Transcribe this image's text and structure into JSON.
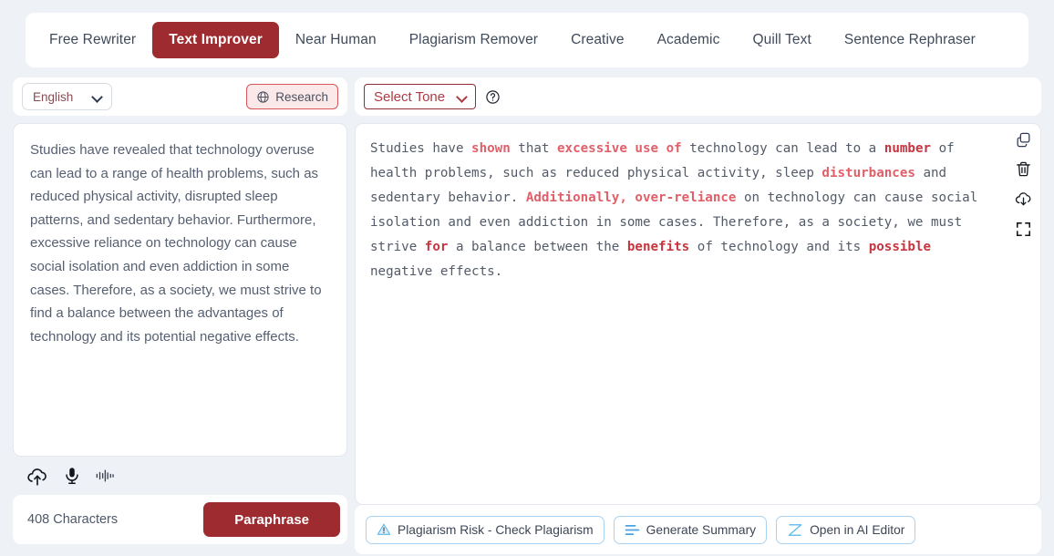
{
  "tabs": [
    {
      "label": "Free Rewriter",
      "active": false
    },
    {
      "label": "Text Improver",
      "active": true
    },
    {
      "label": "Near Human",
      "active": false
    },
    {
      "label": "Plagiarism Remover",
      "active": false
    },
    {
      "label": "Creative",
      "active": false
    },
    {
      "label": "Academic",
      "active": false
    },
    {
      "label": "Quill Text",
      "active": false
    },
    {
      "label": "Sentence Rephraser",
      "active": false
    }
  ],
  "left": {
    "language": "English",
    "research_label": "Research",
    "research_icon": "globe-icon",
    "input_text": "Studies have revealed that technology overuse can lead to a range of health problems, such as reduced physical activity, disrupted sleep patterns, and sedentary behavior. Furthermore, excessive reliance on technology can cause social isolation and even addiction in some cases. Therefore, as a society, we must strive to find a balance between the advantages of technology and its potential negative effects.",
    "media_icons": [
      "cloud-upload-icon",
      "microphone-icon",
      "waveform-icon"
    ],
    "char_count": "408 Characters",
    "paraphrase_label": "Paraphrase"
  },
  "right": {
    "tone": "Select Tone",
    "help_icon": "question-circle-icon",
    "rail_icons": [
      "copy-icon",
      "trash-icon",
      "cloud-download-icon",
      "fullscreen-icon"
    ],
    "output_segments": [
      {
        "t": "Studies have ",
        "h": 0
      },
      {
        "t": "shown",
        "h": 1
      },
      {
        "t": " that ",
        "h": 0
      },
      {
        "t": "excessive use of",
        "h": 1
      },
      {
        "t": " technology can lead to a ",
        "h": 0
      },
      {
        "t": "number",
        "h": 2
      },
      {
        "t": " of health problems, such as reduced physical activity, sleep ",
        "h": 0
      },
      {
        "t": "disturbances",
        "h": 1
      },
      {
        "t": " and sedentary behavior. ",
        "h": 0
      },
      {
        "t": "Additionally, over-reliance",
        "h": 1
      },
      {
        "t": " on technology can cause social isolation and even addiction in some cases. Therefore, as a society, we must strive ",
        "h": 0
      },
      {
        "t": "for",
        "h": 2
      },
      {
        "t": " a balance between the ",
        "h": 0
      },
      {
        "t": "benefits",
        "h": 2
      },
      {
        "t": " of technology and its ",
        "h": 0
      },
      {
        "t": "possible",
        "h": 2
      },
      {
        "t": " negative effects.",
        "h": 0
      }
    ],
    "actions": [
      {
        "label": "Plagiarism Risk - Check Plagiarism",
        "icon": "warning-triangle-icon"
      },
      {
        "label": "Generate Summary",
        "icon": "summary-lines-icon"
      },
      {
        "label": "Open in AI Editor",
        "icon": "ai-editor-icon"
      }
    ]
  },
  "colors": {
    "accent": "#9d2b30",
    "accent_light": "#b03a41",
    "highlight": "#e0606a",
    "page_bg": "#eef2f7",
    "action_border": "#a9d2f0"
  }
}
